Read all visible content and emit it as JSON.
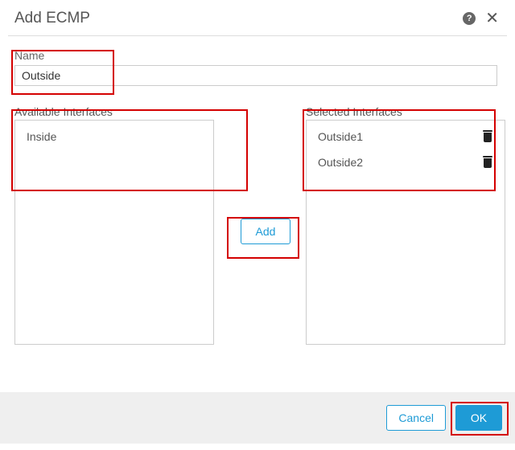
{
  "dialog": {
    "title": "Add ECMP",
    "help_tooltip": "?",
    "close_label": "✕"
  },
  "name": {
    "label": "Name",
    "value": "Outside"
  },
  "available": {
    "caption": "Available Interfaces",
    "items": [
      "Inside"
    ]
  },
  "selected": {
    "caption": "Selected Interfaces",
    "items": [
      "Outside1",
      "Outside2"
    ]
  },
  "buttons": {
    "add": "Add",
    "cancel": "Cancel",
    "ok": "OK"
  }
}
